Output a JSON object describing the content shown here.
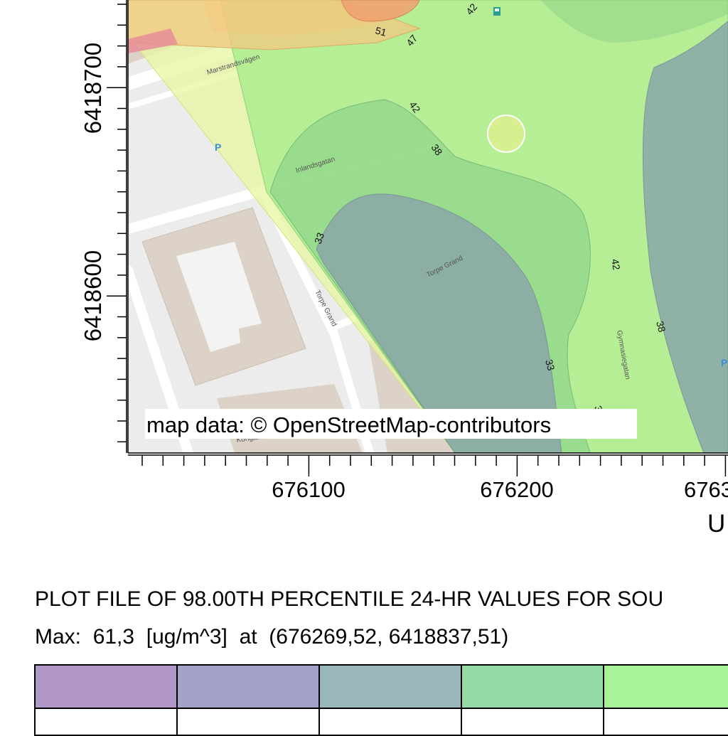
{
  "map": {
    "credit": "map data: © OpenStreetMap-contributors",
    "streets": {
      "marstrandsvagen": "Marstrandsvägen",
      "inlandsgatan": "Inlandsgatan",
      "torpe_grand_1": "Torpe Grand",
      "torpe_grand_2": "Torpe Grand",
      "gymnasiegatan": "Gymnasiegatan",
      "kongahalla": "Kongahalla"
    },
    "parking_label": "P",
    "contour_labels": [
      "51",
      "47",
      "42",
      "42",
      "38",
      "33",
      "42",
      "38",
      "33",
      "33"
    ]
  },
  "axes": {
    "y_ticks": [
      "6418700",
      "6418600"
    ],
    "x_ticks": [
      "676100",
      "676200",
      "6763"
    ],
    "x_label": "U"
  },
  "plot_title": "PLOT FILE OF 98.00TH PERCENTILE 24-HR VALUES FOR SOU",
  "max_info": {
    "label": "Max:",
    "value": "61,3",
    "unit": "[ug/m^3]",
    "at": "at",
    "location": "(676269,52, 6418837,51)"
  },
  "legend": {
    "swatches": [
      "#b297c9",
      "#a3a3c8",
      "#9ab8bb",
      "#94d9a6",
      "#a8f29a"
    ]
  },
  "colors": {
    "level_51": "#f0a070",
    "level_47": "#f2c880",
    "level_42": "#e4f59a",
    "level_38": "#a8ec8e",
    "level_33": "#8fd48a",
    "level_low": "#8aa6a8",
    "basemap_bg": "#ececec",
    "building": "#ddd2c8"
  }
}
